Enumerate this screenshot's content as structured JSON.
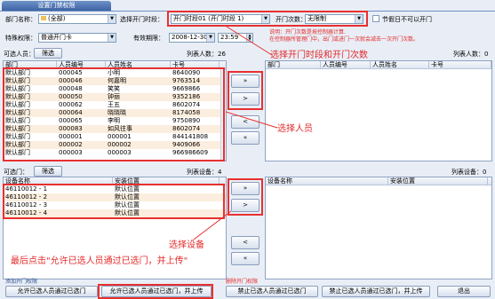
{
  "window": {
    "tab_title": "设置门禁权限"
  },
  "filters": {
    "department_label": "部门名称：",
    "department_value": "(全部)",
    "period_label": "选择开门时段：",
    "period_value": "开门时段01 (开门时段 1)",
    "count_label": "开门次数：",
    "count_value": "无限制",
    "holiday_label": "节假日不可以开门",
    "special_label": "特殊权限：",
    "special_value": "普通开门卡",
    "valid_label": "有效期限：",
    "valid_date": "2008-12-30",
    "valid_time": "23:59",
    "explain_line1": "说明：开门次数是按控制器计算.",
    "explain_line2": "在控制器所管理门中，出门或进门一次就会减去一次开门次数。"
  },
  "annotations": {
    "period_note": "选择开门时段和开门次数",
    "person_note": "选择人员",
    "device_note": "选择设备",
    "final_note": "最后点击\"允许已选人员通过已选门，并上传\""
  },
  "persons_available": {
    "label": "可选人员：",
    "filter_button": "筛选",
    "count_label": "列表人数：26",
    "columns": [
      "部门",
      "人员编号",
      "人员姓名",
      "卡号"
    ],
    "rows": [
      [
        "默认部门",
        "000045",
        "小明",
        "8640090"
      ],
      [
        "默认部门",
        "000046",
        "何嘉明",
        "9763514"
      ],
      [
        "默认部门",
        "000048",
        "笑笑",
        "9669866"
      ],
      [
        "默认部门",
        "000050",
        "钟丽",
        "9352186"
      ],
      [
        "默认部门",
        "000062",
        "王五",
        "8602074"
      ],
      [
        "默认部门",
        "000064",
        "晓晓晓",
        "8174058"
      ],
      [
        "默认部门",
        "000065",
        "李明",
        "9750890"
      ],
      [
        "默认部门",
        "000083",
        "如风往事",
        "8602074"
      ],
      [
        "默认部门",
        "000001",
        "000001",
        "844141808"
      ],
      [
        "默认部门",
        "000002",
        "000002",
        "9409066"
      ],
      [
        "默认部门",
        "000003",
        "000003",
        "966986609"
      ]
    ]
  },
  "persons_selected": {
    "count_label": "列表人数：0",
    "columns": [
      "部门",
      "人员编号",
      "人员姓名",
      "卡号"
    ]
  },
  "person_buttons": [
    "»",
    ">",
    "<",
    "«"
  ],
  "doors_available": {
    "label": "可选门：",
    "filter_button": "筛选",
    "count_label": "列表设备：4",
    "columns": [
      "设备名称",
      "安装位置"
    ],
    "rows": [
      [
        "46110012 - 1",
        "默认位置"
      ],
      [
        "46110012 - 2",
        "默认位置"
      ],
      [
        "46110012 - 3",
        "默认位置"
      ],
      [
        "46110012 - 4",
        "默认位置"
      ]
    ]
  },
  "doors_selected": {
    "count_label": "列表设备：0",
    "columns": [
      "设备名称",
      "安装位置"
    ]
  },
  "door_buttons": [
    "»",
    ">",
    "<",
    "«"
  ],
  "bottom": {
    "add_group": "添加开门权限",
    "allow_button": "允许已选人员通过已选门",
    "allow_upload_button": "允许已选人员通过已选门，并上传",
    "delete_group": "删除开门权限",
    "forbid_button": "禁止已选人员通过已选门",
    "forbid_upload_button": "禁止已选人员通过已选门，并上传",
    "exit_button": "退出"
  },
  "colors": {
    "annotation_red": "#e32a2a",
    "row_alt": "#fbeede",
    "header_blue": "#3e63a3"
  }
}
